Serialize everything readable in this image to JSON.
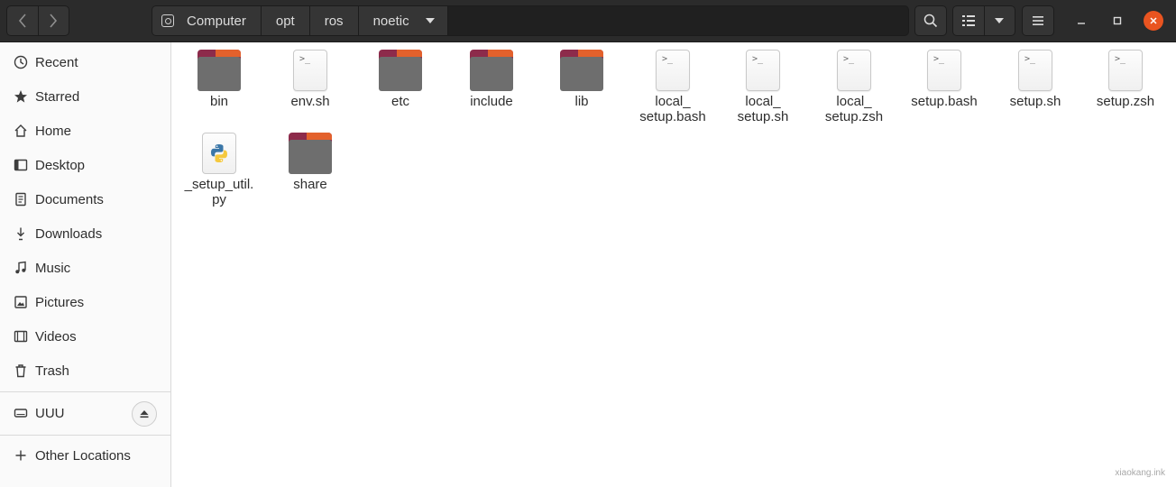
{
  "header": {
    "path": [
      "Computer",
      "opt",
      "ros",
      "noetic"
    ]
  },
  "sidebar": {
    "items": [
      {
        "label": "Recent",
        "icon": "clock-icon"
      },
      {
        "label": "Starred",
        "icon": "star-icon"
      },
      {
        "label": "Home",
        "icon": "home-icon"
      },
      {
        "label": "Desktop",
        "icon": "desktop-icon"
      },
      {
        "label": "Documents",
        "icon": "document-icon"
      },
      {
        "label": "Downloads",
        "icon": "download-icon"
      },
      {
        "label": "Music",
        "icon": "music-icon"
      },
      {
        "label": "Pictures",
        "icon": "pictures-icon"
      },
      {
        "label": "Videos",
        "icon": "film-icon"
      },
      {
        "label": "Trash",
        "icon": "trash-icon"
      }
    ],
    "device": {
      "label": "UUU",
      "icon": "drive-icon"
    },
    "other_locations": "Other Locations"
  },
  "files": [
    {
      "name": "bin",
      "type": "folder"
    },
    {
      "name": "env.sh",
      "type": "script"
    },
    {
      "name": "etc",
      "type": "folder"
    },
    {
      "name": "include",
      "type": "folder"
    },
    {
      "name": "lib",
      "type": "folder"
    },
    {
      "name_lines": [
        "local_",
        "setup.bash"
      ],
      "type": "script"
    },
    {
      "name_lines": [
        "local_",
        "setup.sh"
      ],
      "type": "script"
    },
    {
      "name_lines": [
        "local_",
        "setup.zsh"
      ],
      "type": "script"
    },
    {
      "name": "setup.bash",
      "type": "script"
    },
    {
      "name": "setup.sh",
      "type": "script"
    },
    {
      "name": "setup.zsh",
      "type": "script"
    },
    {
      "name_lines": [
        "_setup_util.",
        "py"
      ],
      "type": "python"
    },
    {
      "name": "share",
      "type": "folder"
    }
  ],
  "colors": {
    "accent": "#e95420",
    "folder_top": "#8d2b4b",
    "folder_body": "#6e6e6e"
  },
  "watermark": "xiaokang.ink"
}
